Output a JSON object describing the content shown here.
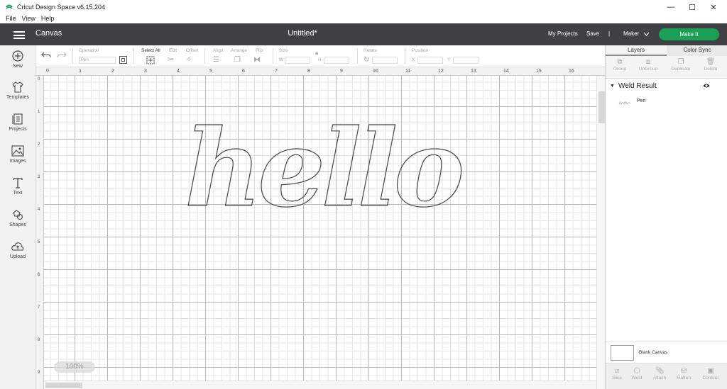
{
  "window": {
    "title": "Cricut Design Space  v6.15.204",
    "controls": [
      "—",
      "☐",
      "✕"
    ]
  },
  "menu": [
    "File",
    "View",
    "Help"
  ],
  "header": {
    "section": "Canvas",
    "doc_title": "Untitled*",
    "my_projects": "My Projects",
    "save": "Save",
    "divider": "|",
    "machine": "Maker",
    "make_it": "Make It"
  },
  "toolbar": {
    "operation_label": "Operation",
    "operation_value": "Pen",
    "select_all": "Select All",
    "edit": "Edit",
    "offset": "Offset",
    "align": "Align",
    "arrange": "Arrange",
    "flip": "Flip",
    "size": "Size",
    "w_label": "W",
    "h_label": "H",
    "rotate": "Rotate",
    "position": "Position",
    "x_label": "X",
    "y_label": "Y"
  },
  "sidebar": [
    {
      "label": "New",
      "icon": "plus-circle-icon"
    },
    {
      "label": "Templates",
      "icon": "tshirt-icon"
    },
    {
      "label": "Projects",
      "icon": "projects-icon"
    },
    {
      "label": "Images",
      "icon": "image-icon"
    },
    {
      "label": "Text",
      "icon": "text-icon"
    },
    {
      "label": "Shapes",
      "icon": "shapes-icon"
    },
    {
      "label": "Upload",
      "icon": "upload-cloud-icon"
    }
  ],
  "ruler": {
    "top": [
      "0",
      "1",
      "2",
      "3",
      "4",
      "5",
      "6",
      "7",
      "8",
      "9",
      "10",
      "11",
      "12",
      "13",
      "14",
      "15",
      "16"
    ],
    "left": [
      "0",
      "1",
      "2",
      "3",
      "4",
      "5",
      "6",
      "7",
      "8",
      "9"
    ]
  },
  "canvas": {
    "zoom": "100%",
    "design_text": "hello"
  },
  "layers_panel": {
    "tabs": [
      "Layers",
      "Color Sync"
    ],
    "actions": [
      "Group",
      "UnGroup",
      "Duplicate",
      "Delete"
    ],
    "group_name": "Weld Result",
    "child_name": "Pen",
    "blank_canvas": "Blank Canvas",
    "bottom_actions": [
      "Slice",
      "Weld",
      "Attach",
      "Flatten",
      "Contour"
    ]
  }
}
